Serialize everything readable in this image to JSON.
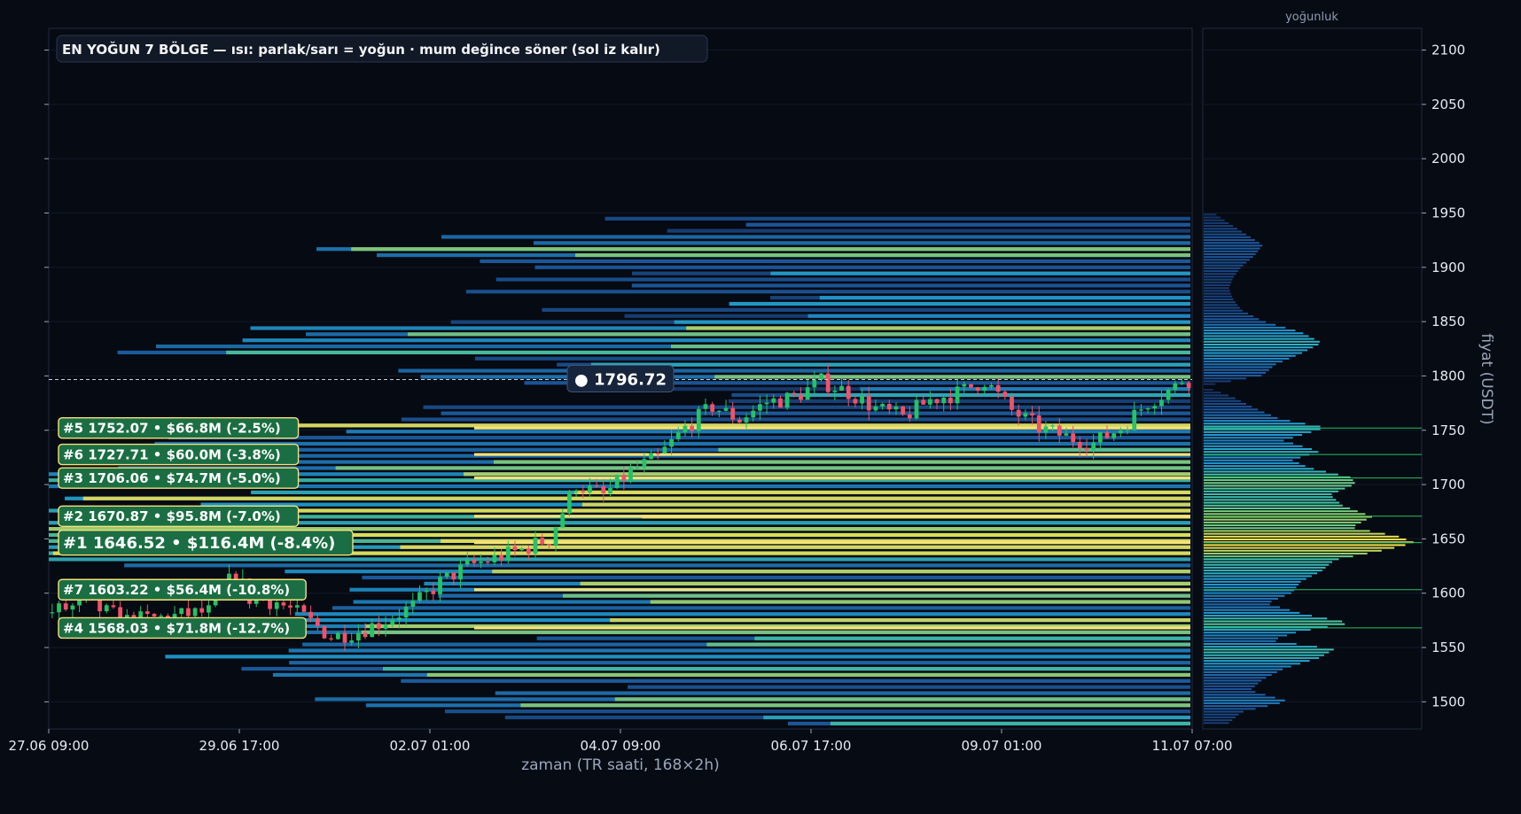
{
  "colors": {
    "background": "#070b13",
    "bull": "#25c266",
    "bear": "#f0526a",
    "zone_box": "#1b6e43",
    "zone_edge": "#f6e27a",
    "heat_low": "#1a3a78",
    "heat_mid": "#22a0d6",
    "heat_high": "#f6e24f"
  },
  "chart_data": {
    "type": "candlestick-heatmap",
    "title": "EN YOĞUN 7 BÖLGE — ısı: parlak/sarı = yoğun · mum değince söner (sol iz kalır)",
    "xlabel": "zaman (TR saati, 168×2h)",
    "ylabel": "fiyat (USDT)",
    "profile_title": "yoğunluk",
    "x_ticks": [
      "27.06 09:00",
      "29.06 17:00",
      "02.07 01:00",
      "04.07 09:00",
      "06.07 17:00",
      "09.07 01:00",
      "11.07 07:00"
    ],
    "y_ticks": [
      1500,
      1550,
      1600,
      1650,
      1700,
      1750,
      1800,
      1850,
      1900,
      1950,
      2000,
      2050,
      2100
    ],
    "ylim": [
      1475,
      2120
    ],
    "bar_count": 168,
    "current_price": {
      "label": "● 1796.72",
      "value": 1796.72
    },
    "price_path": [
      [
        0,
        1582
      ],
      [
        6,
        1590
      ],
      [
        12,
        1575
      ],
      [
        18,
        1578
      ],
      [
        24,
        1583
      ],
      [
        28,
        1620
      ],
      [
        30,
        1595
      ],
      [
        34,
        1592
      ],
      [
        38,
        1578
      ],
      [
        42,
        1560
      ],
      [
        46,
        1565
      ],
      [
        50,
        1575
      ],
      [
        54,
        1588
      ],
      [
        58,
        1610
      ],
      [
        62,
        1625
      ],
      [
        66,
        1632
      ],
      [
        70,
        1640
      ],
      [
        74,
        1650
      ],
      [
        78,
        1700
      ],
      [
        82,
        1690
      ],
      [
        86,
        1712
      ],
      [
        90,
        1725
      ],
      [
        94,
        1752
      ],
      [
        98,
        1772
      ],
      [
        102,
        1760
      ],
      [
        106,
        1776
      ],
      [
        110,
        1780
      ],
      [
        114,
        1795
      ],
      [
        118,
        1785
      ],
      [
        122,
        1770
      ],
      [
        126,
        1762
      ],
      [
        130,
        1778
      ],
      [
        134,
        1784
      ],
      [
        138,
        1796
      ],
      [
        142,
        1768
      ],
      [
        146,
        1752
      ],
      [
        150,
        1744
      ],
      [
        154,
        1738
      ],
      [
        158,
        1752
      ],
      [
        162,
        1776
      ],
      [
        166,
        1790
      ],
      [
        167,
        1796.72
      ]
    ],
    "zones": [
      {
        "rank": 5,
        "label": "#5  1752.07  •  $66.8M  (-2.5%)",
        "price": 1752.07
      },
      {
        "rank": 6,
        "label": "#6  1727.71  •  $60.0M  (-3.8%)",
        "price": 1727.71
      },
      {
        "rank": 3,
        "label": "#3  1706.06  •  $74.7M  (-5.0%)",
        "price": 1706.06
      },
      {
        "rank": 2,
        "label": "#2  1670.87  •  $95.8M  (-7.0%)",
        "price": 1670.87
      },
      {
        "rank": 1,
        "label": "#1  1646.52  •  $116.4M  (-8.4%)",
        "price": 1646.52
      },
      {
        "rank": 7,
        "label": "#7  1603.22  •  $56.4M  (-10.8%)",
        "price": 1603.22
      },
      {
        "rank": 4,
        "label": "#4  1568.03  •  $71.8M  (-12.7%)",
        "price": 1568.03
      }
    ],
    "density_profile": [
      [
        1480,
        0.12
      ],
      [
        1490,
        0.18
      ],
      [
        1500,
        0.4
      ],
      [
        1510,
        0.22
      ],
      [
        1520,
        0.28
      ],
      [
        1530,
        0.38
      ],
      [
        1540,
        0.55
      ],
      [
        1548,
        0.62
      ],
      [
        1556,
        0.32
      ],
      [
        1564,
        0.45
      ],
      [
        1572,
        0.7
      ],
      [
        1580,
        0.48
      ],
      [
        1590,
        0.3
      ],
      [
        1600,
        0.42
      ],
      [
        1610,
        0.46
      ],
      [
        1620,
        0.56
      ],
      [
        1630,
        0.62
      ],
      [
        1640,
        0.88
      ],
      [
        1646,
        1.0
      ],
      [
        1652,
        0.92
      ],
      [
        1660,
        0.7
      ],
      [
        1670,
        0.8
      ],
      [
        1680,
        0.66
      ],
      [
        1690,
        0.6
      ],
      [
        1700,
        0.72
      ],
      [
        1706,
        0.7
      ],
      [
        1715,
        0.5
      ],
      [
        1722,
        0.42
      ],
      [
        1730,
        0.55
      ],
      [
        1740,
        0.38
      ],
      [
        1752,
        0.58
      ],
      [
        1760,
        0.36
      ],
      [
        1770,
        0.24
      ],
      [
        1780,
        0.14
      ],
      [
        1790,
        0.0
      ],
      [
        1800,
        0.28
      ],
      [
        1810,
        0.34
      ],
      [
        1820,
        0.46
      ],
      [
        1830,
        0.56
      ],
      [
        1840,
        0.46
      ],
      [
        1850,
        0.28
      ],
      [
        1860,
        0.18
      ],
      [
        1870,
        0.14
      ],
      [
        1880,
        0.12
      ],
      [
        1890,
        0.14
      ],
      [
        1900,
        0.18
      ],
      [
        1910,
        0.24
      ],
      [
        1920,
        0.28
      ],
      [
        1930,
        0.2
      ],
      [
        1940,
        0.12
      ],
      [
        1948,
        0.06
      ]
    ]
  }
}
